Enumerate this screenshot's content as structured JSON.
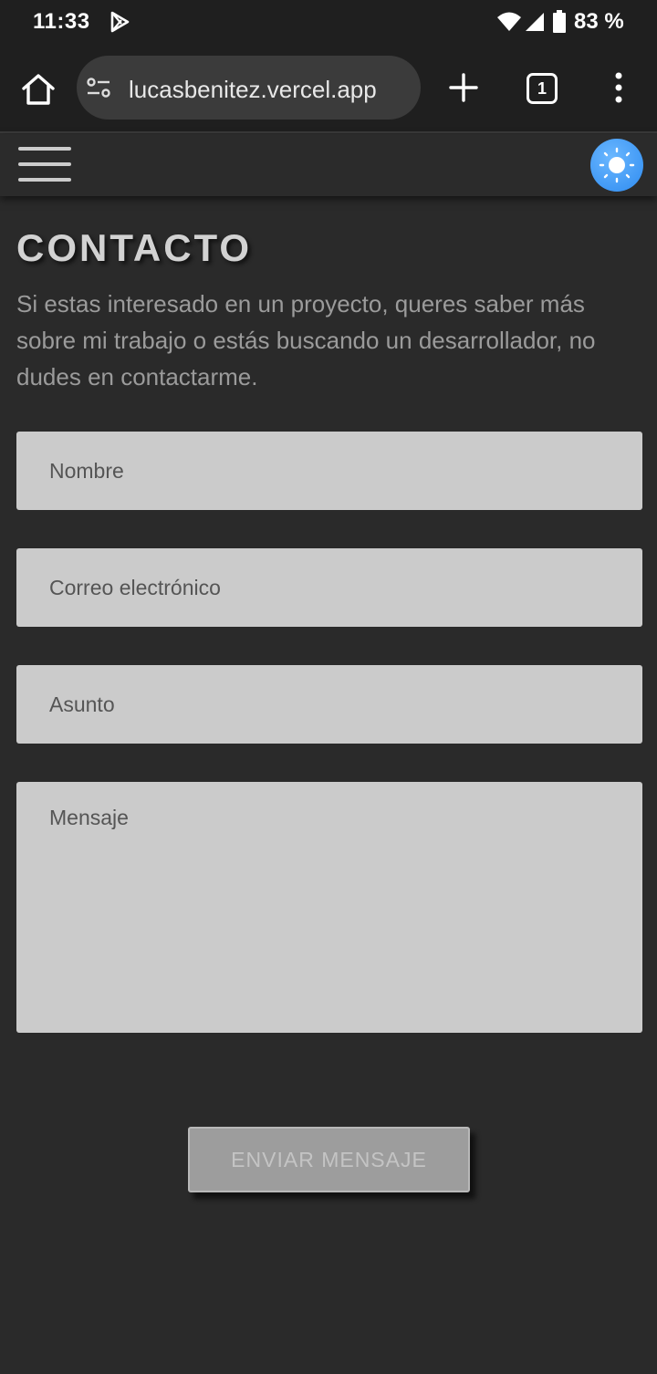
{
  "status_bar": {
    "time": "11:33",
    "battery": "83 %"
  },
  "browser": {
    "url": "lucasbenitez.vercel.app",
    "tab_count": "1"
  },
  "page": {
    "title": "CONTACTO",
    "description": "Si estas interesado en un proyecto, queres saber más sobre mi trabajo o estás buscando un desarrollador, no dudes en contactarme.",
    "form": {
      "name_placeholder": "Nombre",
      "email_placeholder": "Correo electrónico",
      "subject_placeholder": "Asunto",
      "message_placeholder": "Mensaje",
      "submit_label": "ENVIAR MENSAJE"
    }
  },
  "colors": {
    "theme_toggle": "#2e8bf0",
    "field_bg": "#cbcbcb",
    "page_bg": "#2a2a2a"
  }
}
